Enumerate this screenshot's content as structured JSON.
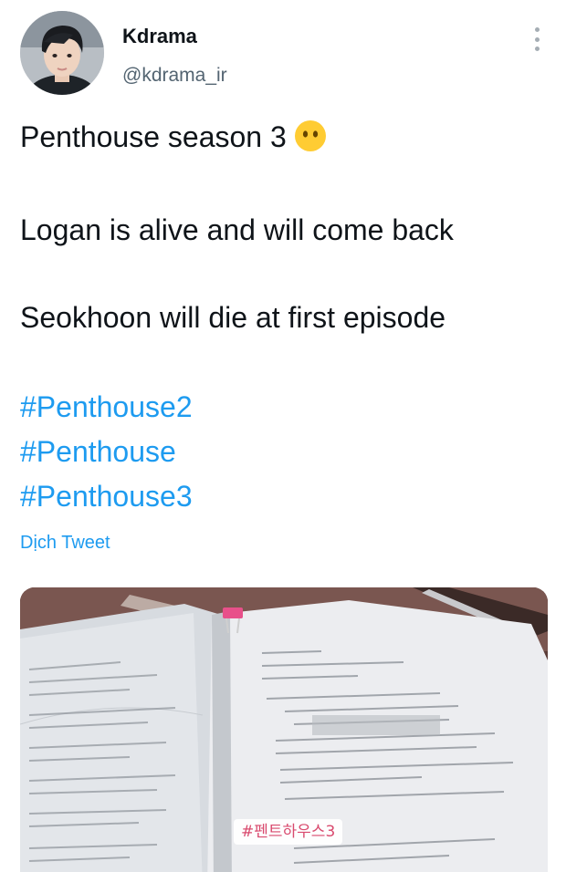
{
  "author": {
    "display_name": "Kdrama",
    "handle": "@kdrama_ir",
    "avatar_icon": "profile-photo"
  },
  "tweet": {
    "lines": [
      "Penthouse season 3",
      "Logan is alive and will come back",
      "Seokhoon will die at first episode"
    ],
    "emoji": "face-without-mouth",
    "hashtags": [
      "#Penthouse2",
      "#Penthouse",
      "#Penthouse3"
    ],
    "translate_label": "Dịch Tweet"
  },
  "media": {
    "sticker_text": "#펜트하우스3"
  },
  "colors": {
    "link": "#1d9bf0",
    "text": "#0f1419",
    "secondary": "#536471"
  }
}
